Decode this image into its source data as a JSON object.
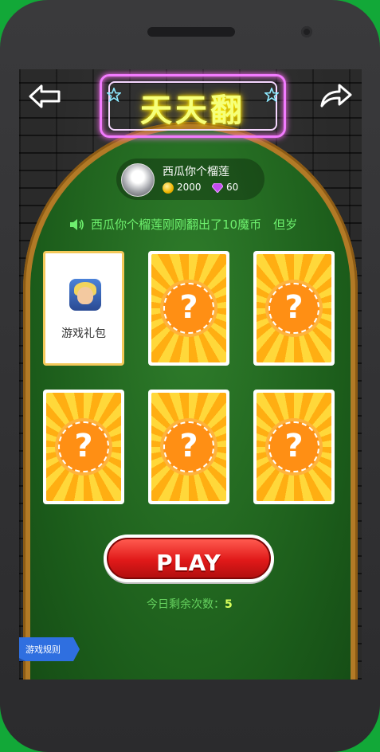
{
  "header": {
    "title": "天天翻"
  },
  "player": {
    "name": "西瓜你个榴莲",
    "coins": "2000",
    "gems": "60"
  },
  "notice": {
    "text": "西瓜你个榴莲刚刚翻出了10魔币　但岁"
  },
  "cards": [
    {
      "type": "gift",
      "label": "游戏礼包"
    },
    {
      "type": "hidden",
      "symbol": "?"
    },
    {
      "type": "hidden",
      "symbol": "?"
    },
    {
      "type": "hidden",
      "symbol": "?"
    },
    {
      "type": "hidden",
      "symbol": "?"
    },
    {
      "type": "hidden",
      "symbol": "?"
    }
  ],
  "play_button": {
    "label": "PLAY"
  },
  "remaining": {
    "label": "今日剩余次数：",
    "value": "5"
  },
  "rules_tab": {
    "label": "游戏规则"
  },
  "colors": {
    "background": "#12a838",
    "felt": "#1b5b1a",
    "accent_red": "#e01919",
    "neon_pink": "#f27bff"
  },
  "icons": [
    "arrow-left-icon",
    "share-arrow-icon",
    "star-icon",
    "coin-icon",
    "gem-icon",
    "speaker-icon",
    "question-mark-icon"
  ]
}
